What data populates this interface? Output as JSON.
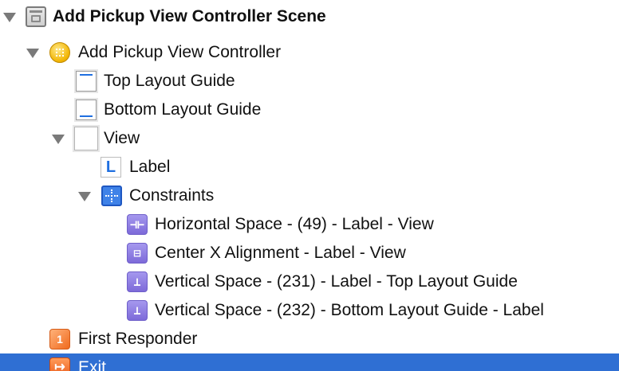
{
  "scene": {
    "title": "Add Pickup View Controller Scene",
    "icon": "storyboard-scene-icon"
  },
  "view_controller": {
    "label": "Add Pickup View Controller",
    "icon": "view-controller-icon"
  },
  "top_layout_guide": {
    "label": "Top Layout Guide",
    "icon": "layout-guide-icon"
  },
  "bottom_layout_guide": {
    "label": "Bottom Layout Guide",
    "icon": "layout-guide-icon"
  },
  "view": {
    "label": "View",
    "icon": "view-icon"
  },
  "label_item": {
    "label": "Label",
    "icon_text": "L",
    "icon": "label-icon"
  },
  "constraints": {
    "label": "Constraints",
    "icon": "constraints-icon",
    "items": [
      {
        "label": "Horizontal Space - (49) - Label - View",
        "icon_text": "⊣⊢",
        "icon": "horizontal-space-constraint-icon"
      },
      {
        "label": "Center X Alignment - Label - View",
        "icon_text": "⊟",
        "icon": "center-x-constraint-icon"
      },
      {
        "label": "Vertical Space - (231) - Label - Top Layout Guide",
        "icon_text": "⊥",
        "icon": "vertical-space-constraint-icon"
      },
      {
        "label": "Vertical Space - (232) - Bottom Layout Guide - Label",
        "icon_text": "⊥",
        "icon": "vertical-space-constraint-icon"
      }
    ]
  },
  "first_responder": {
    "label": "First Responder",
    "icon_text": "1",
    "icon": "first-responder-icon"
  },
  "exit": {
    "label": "Exit",
    "icon_text": "↦",
    "icon": "exit-icon"
  },
  "colors": {
    "selection": "#2f6fd3",
    "constraint_purple": "#7d6ad9",
    "accent_blue": "#1f6fe0",
    "vc_yellow": "#f2b400",
    "exit_orange": "#ea5a1a"
  }
}
